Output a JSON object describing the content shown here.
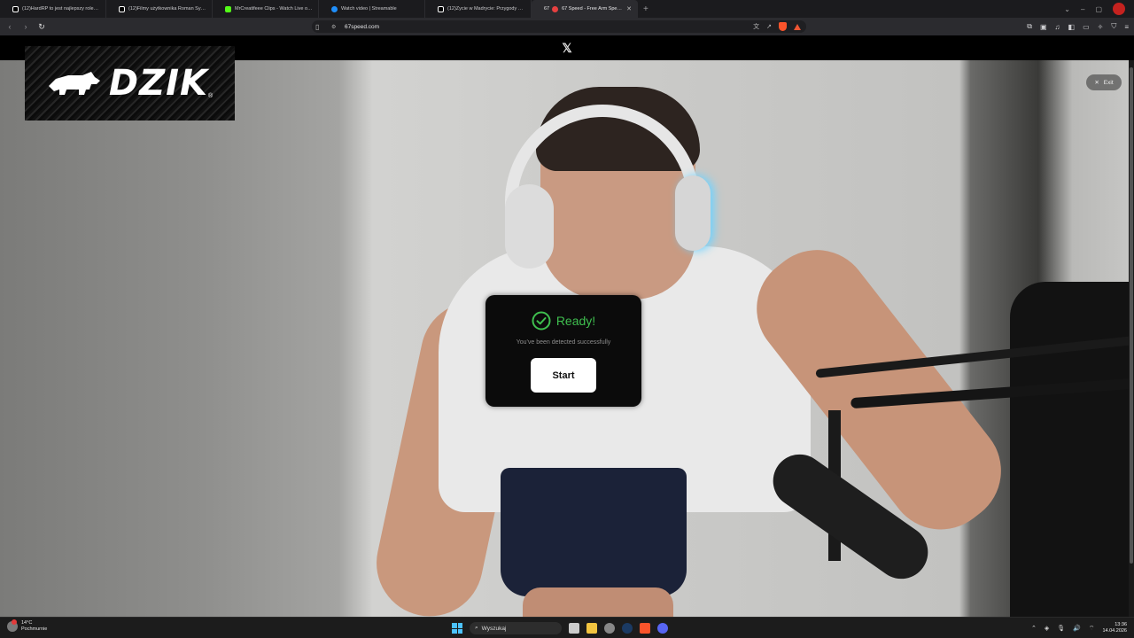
{
  "browser": {
    "tabs": [
      {
        "label": "(12)HardRP to jest najlepszy rolepla...",
        "favicon": "tiktok-icon",
        "color": "#ffffff"
      },
      {
        "label": "(12)Filmy użytkownika Roman Syrot...",
        "favicon": "tiktok-icon",
        "color": "#ffffff"
      },
      {
        "label": "MrCreatifeee Clips - Watch Live on K...",
        "favicon": "kick-icon",
        "color": "#53fc18"
      },
      {
        "label": "Watch video | Streamable",
        "favicon": "streamable-icon",
        "color": "#1f8efa"
      },
      {
        "label": "(12)Życie w Madrycie: Przygody w Tri...",
        "favicon": "tiktok-icon",
        "color": "#ffffff"
      },
      {
        "label": "67 Speed - Free Arm Speed G...",
        "favicon": "67-icon",
        "color": "#e64040",
        "prefix": "67",
        "active": true
      }
    ],
    "new_tab": "+",
    "url": "67speed.com"
  },
  "page": {
    "top_logo": "𝕏",
    "brand": {
      "name": "DZIK",
      "registered": "®"
    },
    "exit_label": "Exit",
    "dialog": {
      "title": "Ready!",
      "message": "You've been detected successfully",
      "start_label": "Start",
      "accent": "#3fbf4f"
    }
  },
  "taskbar": {
    "weather": {
      "temp": "14°C",
      "condition": "Pochmurnie",
      "badge": "1"
    },
    "search_placeholder": "Wyszukaj",
    "time": "13:36",
    "date": "14.04.2026"
  }
}
